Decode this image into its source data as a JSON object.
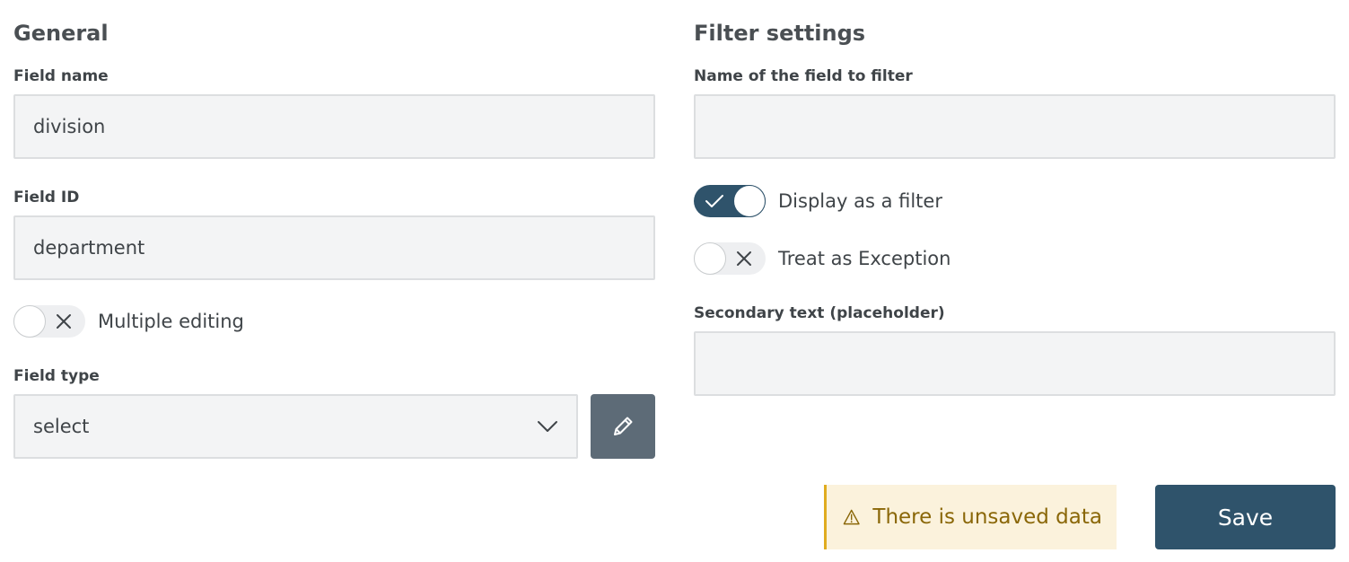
{
  "general": {
    "title": "General",
    "field_name": {
      "label": "Field name",
      "value": "division"
    },
    "field_id": {
      "label": "Field ID",
      "value": "department"
    },
    "multiple_editing": {
      "label": "Multiple editing",
      "checked": false
    },
    "field_type": {
      "label": "Field type",
      "value": "select"
    }
  },
  "filter": {
    "title": "Filter settings",
    "name_to_filter": {
      "label": "Name of the field to filter",
      "value": ""
    },
    "display_as_filter": {
      "label": "Display as a filter",
      "checked": true
    },
    "treat_as_exception": {
      "label": "Treat as Exception",
      "checked": false
    },
    "secondary_text": {
      "label": "Secondary text (placeholder)",
      "value": ""
    }
  },
  "footer": {
    "warning_text": "There is unsaved data",
    "save_label": "Save"
  },
  "icons": {
    "edit": "pencil-icon",
    "dropdown": "chevron-down-icon",
    "warning": "warning-triangle-icon",
    "toggle_on": "check-icon",
    "toggle_off": "close-icon"
  },
  "colors": {
    "primary": "#2f536b",
    "edit_button": "#5d6b77",
    "warning_bg": "#fbf2dc",
    "warning_accent": "#e0ac1f",
    "warning_text": "#8a6708",
    "input_bg": "#f3f4f5"
  }
}
